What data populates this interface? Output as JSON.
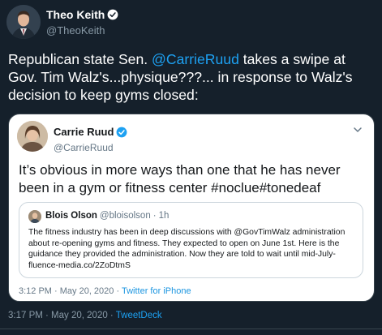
{
  "tweet": {
    "author": {
      "name": "Theo Keith",
      "handle": "@TheoKeith",
      "verified": true
    },
    "text_before": "Republican state Sen. ",
    "mention": "@CarrieRuud",
    "text_after": " takes a swipe at Gov. Tim Walz's...physique???... in response to Walz's decision to keep gyms closed:",
    "timestamp": "3:17 PM · May 20, 2020",
    "separator": " · ",
    "source": "TweetDeck"
  },
  "quoted": {
    "author": {
      "name": "Carrie Ruud",
      "handle": "@CarrieRuud",
      "verified": true
    },
    "text": "It’s obvious in more ways than one that he has never been in a gym or fitness center #noclue#tonedeaf",
    "timestamp": "3:12 PM · May 20, 2020",
    "separator": " · ",
    "source": "Twitter for iPhone",
    "nested": {
      "author": {
        "name": "Blois Olson",
        "handle": "@bloisolson"
      },
      "separator": "·",
      "time": "1h",
      "text": "The fitness industry has been in deep discussions with @GovTimWalz administration about re-opening gyms and fitness.  They expected to open on June 1st.   Here is the guidance they provided the administration.  Now they are told to wait until mid-July- fluence-media.co/2ZoDtmS"
    }
  },
  "colors": {
    "background": "#15202b",
    "accent": "#1da1f2",
    "muted": "#8899a6",
    "card": "#ffffff"
  },
  "icons": [
    "verified-badge-icon",
    "chevron-down-icon"
  ]
}
